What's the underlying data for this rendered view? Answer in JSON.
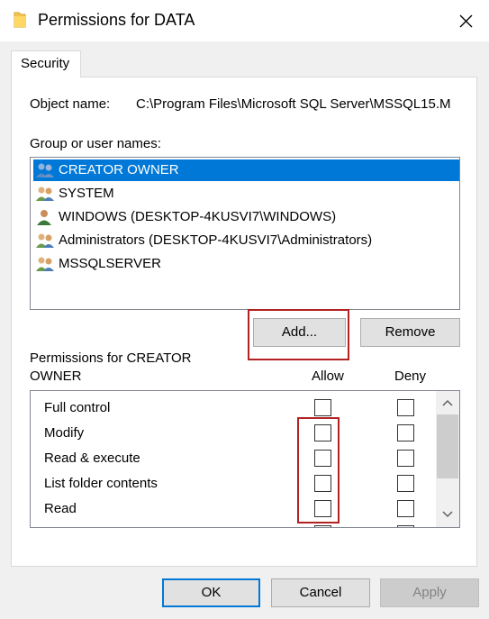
{
  "window": {
    "title": "Permissions for DATA",
    "close_icon": "close-icon",
    "folder_icon": "folder-icon"
  },
  "tabs": [
    {
      "label": "Security",
      "active": true
    }
  ],
  "object": {
    "label": "Object name:",
    "value": "C:\\Program Files\\Microsoft SQL Server\\MSSQL15.M"
  },
  "users": {
    "label": "Group or user names:",
    "items": [
      {
        "name": "CREATOR OWNER",
        "icon": "user-group-icon",
        "selected": true
      },
      {
        "name": "SYSTEM",
        "icon": "user-group-icon",
        "selected": false
      },
      {
        "name": "WINDOWS (DESKTOP-4KUSVI7\\WINDOWS)",
        "icon": "user-icon",
        "selected": false
      },
      {
        "name": "Administrators (DESKTOP-4KUSVI7\\Administrators)",
        "icon": "user-group-icon",
        "selected": false
      },
      {
        "name": "MSSQLSERVER",
        "icon": "user-group-icon",
        "selected": false
      }
    ]
  },
  "buttons": {
    "add": "Add...",
    "remove": "Remove",
    "ok": "OK",
    "cancel": "Cancel",
    "apply": "Apply"
  },
  "permissions": {
    "label_line1": "Permissions for CREATOR",
    "label_line2": "OWNER",
    "allow_header": "Allow",
    "deny_header": "Deny",
    "items": [
      {
        "name": "Full control",
        "allow": false,
        "deny": false
      },
      {
        "name": "Modify",
        "allow": false,
        "deny": false
      },
      {
        "name": "Read & execute",
        "allow": false,
        "deny": false
      },
      {
        "name": "List folder contents",
        "allow": false,
        "deny": false
      },
      {
        "name": "Read",
        "allow": false,
        "deny": false
      }
    ]
  },
  "colors": {
    "selection": "#0078d7",
    "annotation": "#b22222",
    "dialog_bg": "#f0f0f0"
  }
}
